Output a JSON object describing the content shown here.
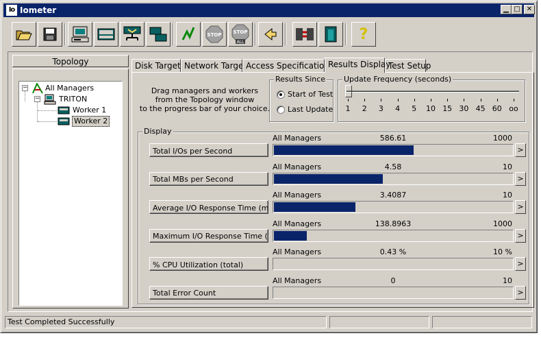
{
  "window": {
    "title": "Iometer",
    "app_icon": "Io"
  },
  "toolbar": {
    "buttons": [
      {
        "name": "open-icon"
      },
      {
        "name": "save-icon"
      },
      {
        "name": "new-manager-icon"
      },
      {
        "name": "new-disk-worker-icon"
      },
      {
        "name": "new-network-worker-icon"
      },
      {
        "name": "duplicate-worker-icon"
      },
      {
        "name": "start-tests-icon"
      },
      {
        "name": "stop-icon",
        "label": "STOP"
      },
      {
        "name": "stop-all-icon",
        "label": "STOP",
        "sublabel": "ALL"
      },
      {
        "name": "reset-workers-icon"
      },
      {
        "name": "disconnect-icon"
      },
      {
        "name": "exit-icon"
      },
      {
        "name": "help-icon",
        "label": "?"
      }
    ]
  },
  "topology": {
    "heading": "Topology",
    "tree": [
      {
        "label": "All Managers",
        "level": 0,
        "expander": "−",
        "icon": "all-managers-icon"
      },
      {
        "label": "TRITON",
        "level": 1,
        "expander": "−",
        "icon": "computer-icon"
      },
      {
        "label": "Worker 1",
        "level": 2,
        "icon": "disk-worker-icon"
      },
      {
        "label": "Worker 2",
        "level": 2,
        "icon": "disk-worker-icon",
        "selected": true
      }
    ]
  },
  "tabs": [
    "Disk Targets",
    "Network Targets",
    "Access Specifications",
    "Results Display",
    "Test Setup"
  ],
  "active_tab": "Results Display",
  "instructions": {
    "line1": "Drag managers and workers",
    "line2": "from the Topology window",
    "line3": "to the progress bar of your choice."
  },
  "results_since": {
    "label": "Results Since",
    "options": [
      "Start of Test",
      "Last Update"
    ],
    "selected": "Start of Test"
  },
  "update_frequency": {
    "label": "Update Frequency (seconds)",
    "ticks": [
      "1",
      "2",
      "3",
      "4",
      "5",
      "10",
      "15",
      "30",
      "45",
      "60",
      "oo"
    ],
    "selected": "1"
  },
  "display": {
    "label": "Display",
    "metrics": [
      {
        "button": "Total I/Os per Second",
        "source": "All Managers",
        "value": "586.61",
        "max": "1000",
        "fraction": 0.5866
      },
      {
        "button": "Total MBs per Second",
        "source": "All Managers",
        "value": "4.58",
        "max": "10",
        "fraction": 0.458
      },
      {
        "button": "Average I/O Response Time (ms)",
        "source": "All Managers",
        "value": "3.4087",
        "max": "10",
        "fraction": 0.3409
      },
      {
        "button": "Maximum I/O Response Time (ms)",
        "source": "All Managers",
        "value": "138.8963",
        "max": "1000",
        "fraction": 0.1389
      },
      {
        "button": "% CPU Utilization (total)",
        "source": "All Managers",
        "value": "0.43 %",
        "max": "10 %",
        "fraction": 0.0
      },
      {
        "button": "Total Error Count",
        "source": "All Managers",
        "value": "0",
        "max": "10",
        "fraction": 0.0
      }
    ],
    "arrow_label": ">"
  },
  "status_bar": {
    "message": "Test Completed Successfully"
  },
  "colors": {
    "title_bar": "#0a246a",
    "bar_fill": "#0a246a",
    "face": "#d4d0c8"
  }
}
